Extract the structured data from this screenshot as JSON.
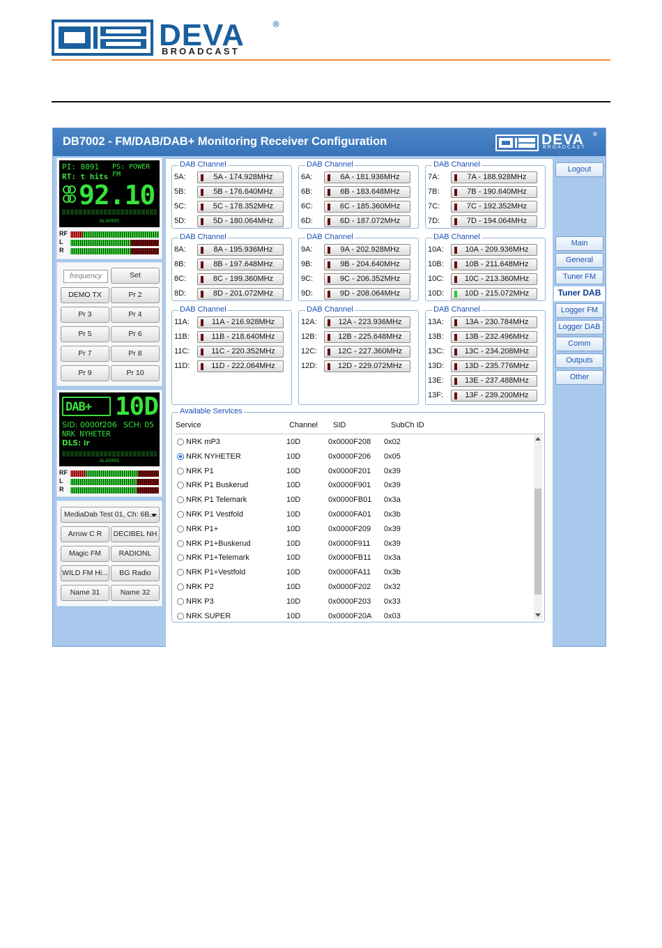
{
  "brand": {
    "name": "DEVA",
    "tagline": "BROADCAST",
    "reg": "®"
  },
  "app": {
    "title": "DB7002 - FM/DAB/DAB+ Monitoring Receiver Configuration",
    "logo": {
      "name": "DEVA",
      "tagline": "BROADCAST",
      "reg": "®"
    }
  },
  "fm_display": {
    "line1_pi": "PI: 8091",
    "line1_ps": "PS: POWER  FM",
    "rt": "RT: t hits",
    "frequency": "92.10",
    "stereo_icon": "stereo-rings-icon",
    "alarms_label": "ALARMS"
  },
  "meters": {
    "rf": "RF",
    "l": "L",
    "r": "R"
  },
  "fm_presets": {
    "frequency_placeholder": "frequency",
    "set": "Set",
    "buttons": [
      "DEMO TX",
      "Pr 2",
      "Pr 3",
      "Pr 4",
      "Pr 5",
      "Pr 6",
      "Pr 7",
      "Pr 8",
      "Pr 9",
      "Pr 10"
    ]
  },
  "dab_display": {
    "logo": "DAB+",
    "channel": "10D",
    "sid": "SID: 0000f206",
    "sch": "SCH: 05",
    "service": "NRK  NYHETER",
    "dls": "DLS: ir",
    "alarms_label": "ALARMS"
  },
  "dab_presets": {
    "select_value": "MediaDab Test 01, Ch: 6B,...",
    "buttons": [
      "Arrow C R",
      "DECIBEL NH",
      "Magic FM",
      "RADIONL",
      "WILD FM Hi...",
      "BG Radio",
      "Name 31",
      "Name 32"
    ]
  },
  "channel_groups_legend": "DAB Channel",
  "channel_groups": [
    {
      "rows": [
        {
          "label": "5A:",
          "value": "5A - 174.928MHz",
          "on": false
        },
        {
          "label": "5B:",
          "value": "5B - 176.640MHz",
          "on": false
        },
        {
          "label": "5C:",
          "value": "5C - 178.352MHz",
          "on": false
        },
        {
          "label": "5D:",
          "value": "5D - 180.064MHz",
          "on": false
        }
      ]
    },
    {
      "rows": [
        {
          "label": "6A:",
          "value": "6A - 181.936MHz",
          "on": false
        },
        {
          "label": "6B:",
          "value": "6B - 183.648MHz",
          "on": false
        },
        {
          "label": "6C:",
          "value": "6C - 185.360MHz",
          "on": false
        },
        {
          "label": "6D:",
          "value": "6D - 187.072MHz",
          "on": false
        }
      ]
    },
    {
      "rows": [
        {
          "label": "7A:",
          "value": "7A - 188.928MHz",
          "on": false
        },
        {
          "label": "7B:",
          "value": "7B - 190.640MHz",
          "on": false
        },
        {
          "label": "7C:",
          "value": "7C - 192.352MHz",
          "on": false
        },
        {
          "label": "7D:",
          "value": "7D - 194.064MHz",
          "on": false
        }
      ]
    },
    {
      "rows": [
        {
          "label": "8A:",
          "value": "8A - 195.936MHz",
          "on": false
        },
        {
          "label": "8B:",
          "value": "8B - 197.648MHz",
          "on": false
        },
        {
          "label": "8C:",
          "value": "8C - 199.360MHz",
          "on": false
        },
        {
          "label": "8D:",
          "value": "8D - 201.072MHz",
          "on": false
        }
      ]
    },
    {
      "rows": [
        {
          "label": "9A:",
          "value": "9A - 202.928MHz",
          "on": false
        },
        {
          "label": "9B:",
          "value": "9B - 204.640MHz",
          "on": false
        },
        {
          "label": "9C:",
          "value": "9C - 206.352MHz",
          "on": false
        },
        {
          "label": "9D:",
          "value": "9D - 208.064MHz",
          "on": false
        }
      ]
    },
    {
      "rows": [
        {
          "label": "10A:",
          "value": "10A - 209.936MHz",
          "on": false
        },
        {
          "label": "10B:",
          "value": "10B - 211.648MHz",
          "on": false
        },
        {
          "label": "10C:",
          "value": "10C - 213.360MHz",
          "on": false
        },
        {
          "label": "10D:",
          "value": "10D - 215.072MHz",
          "on": true
        }
      ]
    },
    {
      "rows": [
        {
          "label": "11A:",
          "value": "11A - 216.928MHz",
          "on": false
        },
        {
          "label": "11B:",
          "value": "11B - 218.640MHz",
          "on": false
        },
        {
          "label": "11C:",
          "value": "11C - 220.352MHz",
          "on": false
        },
        {
          "label": "11D:",
          "value": "11D - 222.064MHz",
          "on": false
        }
      ]
    },
    {
      "rows": [
        {
          "label": "12A:",
          "value": "12A - 223.936MHz",
          "on": false
        },
        {
          "label": "12B:",
          "value": "12B - 225.648MHz",
          "on": false
        },
        {
          "label": "12C:",
          "value": "12C - 227.360MHz",
          "on": false
        },
        {
          "label": "12D:",
          "value": "12D - 229.072MHz",
          "on": false
        }
      ]
    },
    {
      "rows": [
        {
          "label": "13A:",
          "value": "13A - 230.784MHz",
          "on": false
        },
        {
          "label": "13B:",
          "value": "13B - 232.496MHz",
          "on": false
        },
        {
          "label": "13C:",
          "value": "13C - 234.208MHz",
          "on": false
        },
        {
          "label": "13D:",
          "value": "13D - 235.776MHz",
          "on": false
        },
        {
          "label": "13E:",
          "value": "13E - 237.488MHz",
          "on": false
        },
        {
          "label": "13F:",
          "value": "13F - 239.200MHz",
          "on": false
        }
      ]
    }
  ],
  "services": {
    "legend": "Available Services",
    "headers": {
      "service": "Service",
      "channel": "Channel",
      "sid": "SID",
      "subch": "SubCh ID"
    },
    "rows": [
      {
        "name": "NRK mP3",
        "channel": "10D",
        "sid": "0x0000F208",
        "subch": "0x02",
        "selected": false
      },
      {
        "name": "NRK NYHETER",
        "channel": "10D",
        "sid": "0x0000F206",
        "subch": "0x05",
        "selected": true
      },
      {
        "name": "NRK P1",
        "channel": "10D",
        "sid": "0x0000F201",
        "subch": "0x39",
        "selected": false
      },
      {
        "name": "NRK P1 Buskerud",
        "channel": "10D",
        "sid": "0x0000F901",
        "subch": "0x39",
        "selected": false
      },
      {
        "name": "NRK P1 Telemark",
        "channel": "10D",
        "sid": "0x0000FB01",
        "subch": "0x3a",
        "selected": false
      },
      {
        "name": "NRK P1 Vestfold",
        "channel": "10D",
        "sid": "0x0000FA01",
        "subch": "0x3b",
        "selected": false
      },
      {
        "name": "NRK P1+",
        "channel": "10D",
        "sid": "0x0000F209",
        "subch": "0x39",
        "selected": false
      },
      {
        "name": "NRK P1+Buskerud",
        "channel": "10D",
        "sid": "0x0000F911",
        "subch": "0x39",
        "selected": false
      },
      {
        "name": "NRK P1+Telemark",
        "channel": "10D",
        "sid": "0x0000FB11",
        "subch": "0x3a",
        "selected": false
      },
      {
        "name": "NRK P1+Vestfold",
        "channel": "10D",
        "sid": "0x0000FA11",
        "subch": "0x3b",
        "selected": false
      },
      {
        "name": "NRK P2",
        "channel": "10D",
        "sid": "0x0000F202",
        "subch": "0x32",
        "selected": false
      },
      {
        "name": "NRK P3",
        "channel": "10D",
        "sid": "0x0000F203",
        "subch": "0x33",
        "selected": false
      },
      {
        "name": "NRK SUPER",
        "channel": "10D",
        "sid": "0x0000F20A",
        "subch": "0x03",
        "selected": false
      }
    ]
  },
  "nav": {
    "logout": "Logout",
    "items": [
      "Main",
      "General",
      "Tuner FM",
      "Tuner DAB",
      "Logger FM",
      "Logger DAB",
      "Comm",
      "Outputs",
      "Other"
    ],
    "active": "Tuner DAB"
  },
  "colors": {
    "accent": "#1a5f9e",
    "rule": "#e8893a",
    "panel": "#a8c8ec",
    "lcd_green": "#39e23b"
  }
}
